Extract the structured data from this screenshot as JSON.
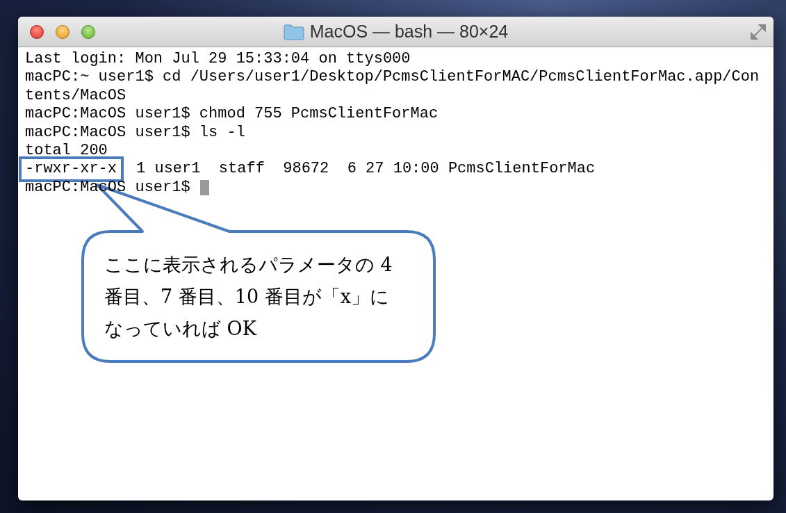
{
  "window": {
    "title": "MacOS — bash — 80×24"
  },
  "terminal": {
    "lines": [
      {
        "segments": [
          {
            "text": "Last login: Mon Jul 29 15:33:04 on ttys000",
            "highlighted": false
          }
        ]
      },
      {
        "segments": [
          {
            "text": "macPC:~ user1$ cd /Users/user1/Desktop/PcmsClientForMAC/PcmsClientForMac.app/Con",
            "highlighted": false
          }
        ]
      },
      {
        "segments": [
          {
            "text": "tents/MacOS",
            "highlighted": false
          }
        ]
      },
      {
        "segments": [
          {
            "text": "macPC:MacOS user1$ chmod 755 PcmsClientForMac",
            "highlighted": false
          }
        ]
      },
      {
        "segments": [
          {
            "text": "macPC:MacOS user1$ ls -l",
            "highlighted": false
          }
        ]
      },
      {
        "segments": [
          {
            "text": "total 200",
            "highlighted": false
          }
        ]
      },
      {
        "segments": [
          {
            "text": "-rwxr-xr-x",
            "highlighted": true
          },
          {
            "text": "1 user1  staff  98672  6 27 10:00 PcmsClientForMac",
            "highlighted": false
          }
        ]
      },
      {
        "segments": [
          {
            "text": "macPC:MacOS user1$",
            "highlighted": false
          }
        ],
        "cursor": true
      }
    ]
  },
  "callout": {
    "lines": [
      "ここに表示されるパラメータの 4",
      "番目、7 番目、10 番目が「x」に",
      "なっていれば OK"
    ]
  }
}
